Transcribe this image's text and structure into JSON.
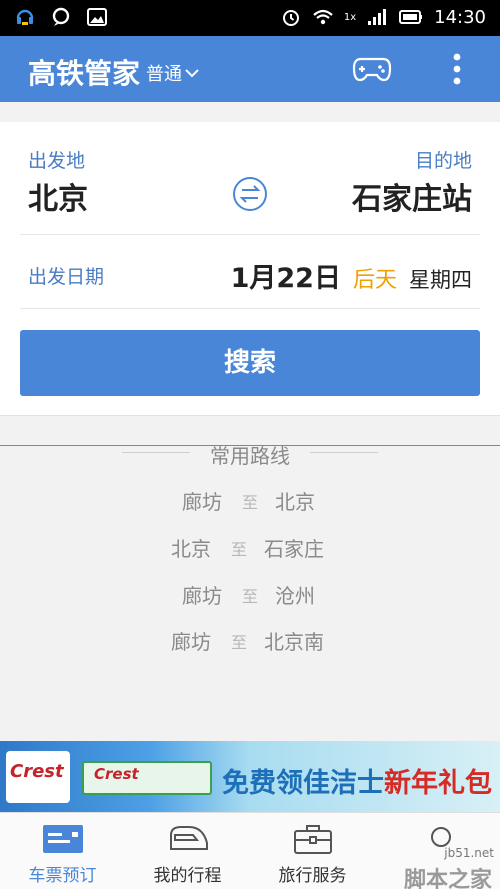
{
  "status_bar": {
    "time": "14:30",
    "signal_label": "1x"
  },
  "app_bar": {
    "title": "高铁管家",
    "mode": "普通"
  },
  "search_card": {
    "from_label": "出发地",
    "from_city": "北京",
    "to_label": "目的地",
    "to_city": "石家庄站",
    "date_label": "出发日期",
    "date_value": "1月22日",
    "date_relative": "后天",
    "date_weekday": "星期四",
    "search_button": "搜索"
  },
  "common_routes": {
    "title": "常用路线",
    "separator": "至",
    "items": [
      {
        "from": "廊坊",
        "to": "北京"
      },
      {
        "from": "北京",
        "to": "石家庄"
      },
      {
        "from": "廊坊",
        "to": "沧州"
      },
      {
        "from": "廊坊",
        "to": "北京南"
      }
    ]
  },
  "ad": {
    "brand": "Crest",
    "slogan_blue": "免费领佳洁士",
    "slogan_red": "新年礼包"
  },
  "bottom_nav": {
    "items": [
      {
        "label": "车票预订",
        "icon": "ticket-icon",
        "active": true
      },
      {
        "label": "我的行程",
        "icon": "train-icon",
        "active": false
      },
      {
        "label": "旅行服务",
        "icon": "briefcase-icon",
        "active": false
      },
      {
        "label": "",
        "icon": "search-icon",
        "active": false
      }
    ]
  },
  "watermark": {
    "site": "jb51.net",
    "name": "脚本之家"
  },
  "colors": {
    "primary": "#4a86d8",
    "accent": "#f0a000",
    "label": "#4a7dc4"
  }
}
